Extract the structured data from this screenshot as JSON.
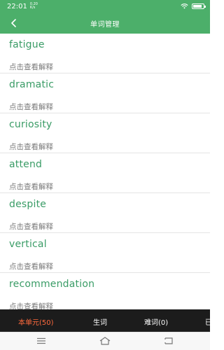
{
  "status_bar": {
    "time": "22:01",
    "speed": "0.20 K/s",
    "wifi_icon": "wifi-icon",
    "battery_icon": "battery-icon"
  },
  "app_bar": {
    "title": "单词管理",
    "back_icon": "chevron-left-icon"
  },
  "colors": {
    "accent": "#4caf6a",
    "word_text": "#3a9c66",
    "tab_active": "#ff6a3d",
    "tab_bar_bg": "#1c1c1c"
  },
  "word_list": [
    {
      "word": "fatigue",
      "hint": "点击查看解释"
    },
    {
      "word": "dramatic",
      "hint": "点击查看解释"
    },
    {
      "word": "curiosity",
      "hint": "点击查看解释"
    },
    {
      "word": "attend",
      "hint": "点击查看解释"
    },
    {
      "word": "despite",
      "hint": "点击查看解释"
    },
    {
      "word": "vertical",
      "hint": "点击查看解释"
    },
    {
      "word": "recommendation",
      "hint": "点击查看解释"
    }
  ],
  "tabs": [
    {
      "label": "本单元(50)",
      "active": true
    },
    {
      "label": "生词",
      "active": false
    },
    {
      "label": "难词(0)",
      "active": false
    },
    {
      "label": "已",
      "active": false
    }
  ],
  "nav_bar": {
    "menu_icon": "menu-icon",
    "home_icon": "home-icon",
    "back_icon": "back-icon"
  }
}
